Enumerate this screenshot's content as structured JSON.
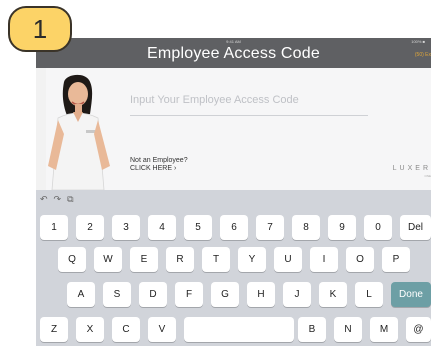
{
  "badge": {
    "number": "1"
  },
  "header": {
    "title": "Employee Access Code",
    "status_time": "9:41 AM",
    "status_battery": "100% ■",
    "left_link": "",
    "right_link": "(50) Ex"
  },
  "form": {
    "input_placeholder": "Input Your Employee Access Code",
    "not_employee": "Not an Employee?",
    "click_here": "CLICK HERE ›"
  },
  "brand": {
    "name": "LUXER",
    "sub": "ONE"
  },
  "keyboard": {
    "tools": [
      "↶",
      "↷",
      "⧉"
    ],
    "rows": [
      [
        "1",
        "2",
        "3",
        "4",
        "5",
        "6",
        "7",
        "8",
        "9",
        "0",
        "Del"
      ],
      [
        "Q",
        "W",
        "E",
        "R",
        "T",
        "Y",
        "U",
        "I",
        "O",
        "P"
      ],
      [
        "A",
        "S",
        "D",
        "F",
        "G",
        "H",
        "J",
        "K",
        "L",
        "Done"
      ],
      [
        "Z",
        "X",
        "C",
        "V",
        "",
        "B",
        "N",
        "M",
        "@"
      ]
    ]
  },
  "colors": {
    "badge": "#fcd367",
    "header": "#5f6063",
    "accent": "#e0a63a",
    "done_key": "#6d9fa5",
    "keyboard": "#d1d4da"
  }
}
